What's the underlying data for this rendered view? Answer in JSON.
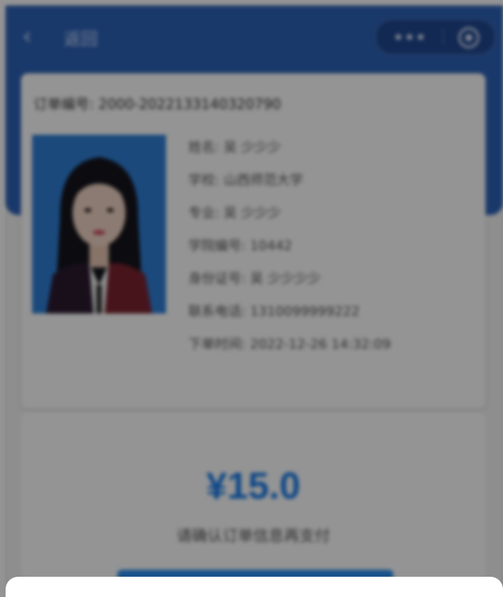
{
  "nav": {
    "back_icon": "chevron-left-icon",
    "title": "返回",
    "more_icon": "more-dots-icon",
    "close_icon": "target-close-icon"
  },
  "card": {
    "order_no": "订单编号: 2000-2022133140320790",
    "info": [
      "姓名: 吴 少少少",
      "学校: 山西师范大学",
      "专业: 吴 少少少",
      "学院编号: 10442",
      "身份证号: 吴 少少少少",
      "联系电话: 1310099999222",
      "下单时间: 2022-12-26 14:32:09"
    ]
  },
  "payment": {
    "price": "¥15.0",
    "note": "请确认订单信息再支付",
    "price_color": "#1a7be8"
  },
  "colors": {
    "header": "#2d62b8",
    "overlay": "rgba(0,0,0,0.42)"
  }
}
